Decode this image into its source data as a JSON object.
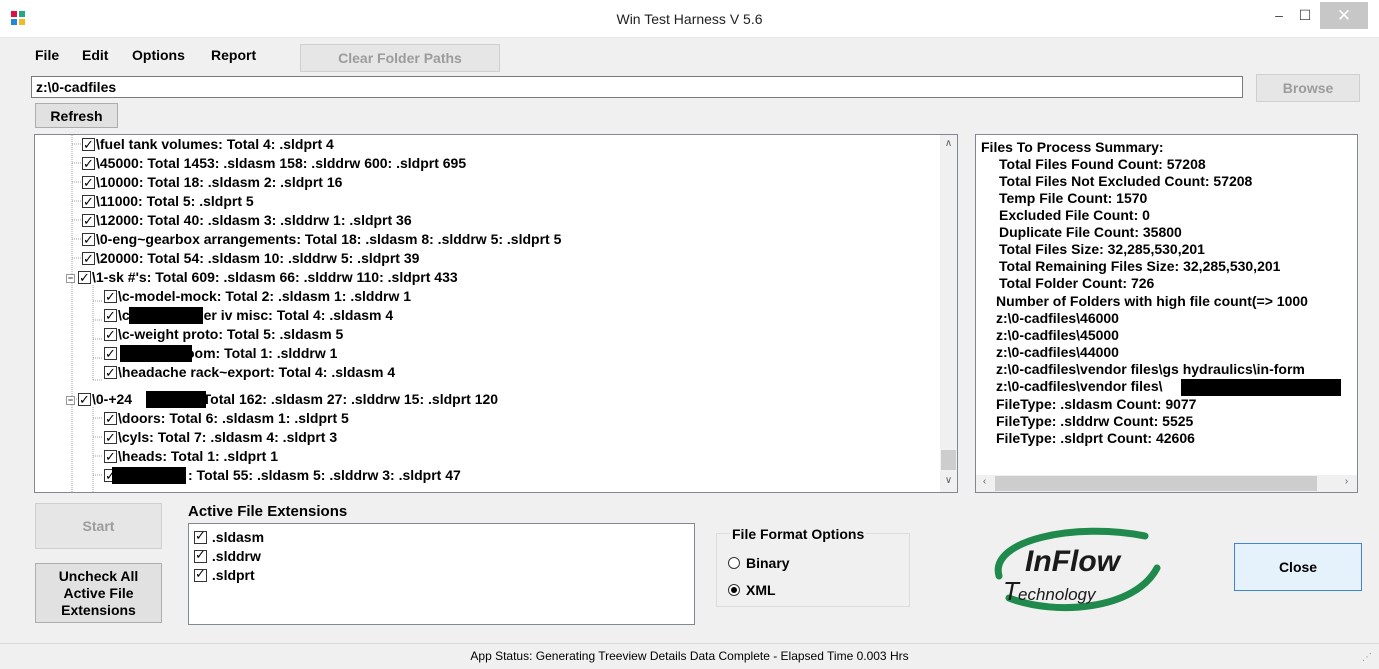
{
  "window": {
    "title": "Win Test Harness V 5.6",
    "min": "–",
    "max": "☐",
    "close": "✕"
  },
  "menu": {
    "file": "File",
    "edit": "Edit",
    "options": "Options",
    "report": "Report"
  },
  "toolbar": {
    "clear_paths": "Clear Folder Paths",
    "browse": "Browse",
    "refresh": "Refresh"
  },
  "path_input": {
    "value": "z:\\0-cadfiles"
  },
  "tree": {
    "rows": [
      "\\fuel tank volumes: Total 4: .sldprt 4",
      "\\45000: Total 1453: .sldasm 158: .slddrw 600: .sldprt 695",
      "\\10000: Total 18: .sldasm 2: .sldprt 16",
      "\\11000: Total 5: .sldprt 5",
      "\\12000: Total 40: .sldasm 3: .slddrw 1: .sldprt 36",
      "\\0-eng~gearbox arrangements: Total 18: .sldasm 8: .slddrw 5: .sldprt 5",
      "\\20000: Total 54: .sldasm 10: .slddrw 5: .sldprt 39",
      "\\1-sk #'s: Total 609: .sldasm 66: .slddrw 110: .sldprt 433",
      "\\c-model-mock: Total 2: .sldasm 1: .slddrw 1",
      "\\c",
      "ier iv misc: Total 4: .sldasm 4",
      "\\c-weight proto: Total 5: .sldasm 5",
      "oom: Total 1: .slddrw 1",
      "\\headache rack~export: Total 4: .sldasm 4",
      "\\0-+24",
      ": Total 162: .sldasm 27: .slddrw 15: .sldprt 120",
      "\\doors: Total 6: .sldasm 1: .sldprt 5",
      "\\cyls: Total 7: .sldasm 4: .sldprt 3",
      "\\heads: Total 1: .sldprt 1",
      ": Total 55: .sldasm 5: .slddrw 3: .sldprt 47"
    ],
    "expander_collapsed": "−"
  },
  "summary": {
    "lines": [
      "Files To Process Summary:",
      "Total Files Found Count: 57208",
      "Total Files Not Excluded Count: 57208",
      "Temp File Count: 1570",
      "Excluded File Count: 0",
      "Duplicate File Count: 35800",
      "Total Files Size: 32,285,530,201",
      "Total Remaining Files Size: 32,285,530,201",
      "Total Folder Count: 726",
      "Number of Folders with high file count(=> 1000",
      "z:\\0-cadfiles\\46000",
      "z:\\0-cadfiles\\45000",
      "z:\\0-cadfiles\\44000",
      "z:\\0-cadfiles\\vendor files\\gs hydraulics\\in-form",
      "z:\\0-cadfiles\\vendor files\\",
      "FileType: .sldasm Count: 9077",
      "FileType: .slddrw Count: 5525",
      "FileType: .sldprt Count: 42606"
    ]
  },
  "buttons": {
    "start": "Start",
    "uncheck_line1": "Uncheck All",
    "uncheck_line2": "Active File",
    "uncheck_line3": "Extensions",
    "close": "Close"
  },
  "extensions": {
    "label": "Active File Extensions",
    "items": [
      ".sldasm",
      ".slddrw",
      ".sldprt"
    ]
  },
  "format": {
    "label": "File Format Options",
    "binary": "Binary",
    "xml": "XML",
    "selected": "XML"
  },
  "logo": {
    "line1": "InFlow",
    "line2": "echnology",
    "t": "T"
  },
  "status": {
    "text": "App Status: Generating Treeview Details Data Complete - Elapsed Time 0.003 Hrs"
  },
  "colors": {
    "logo_green": "#1f8a4c",
    "window_bg": "#f0f0f0",
    "close_hover": "#c7c7c7",
    "button_focus": "#3d86d8"
  }
}
